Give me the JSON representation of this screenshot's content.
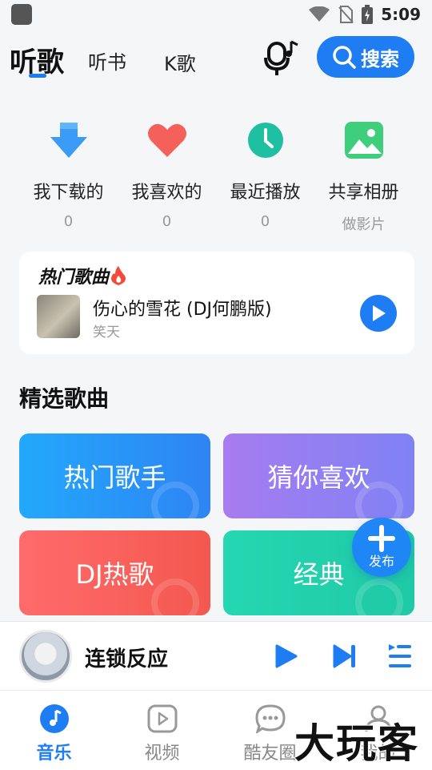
{
  "status_bar": {
    "time": "5:09"
  },
  "top_nav": {
    "tabs": [
      {
        "label": "听歌",
        "active": true
      },
      {
        "label": "听书"
      },
      {
        "label": "K歌"
      }
    ],
    "search_label": "搜索",
    "accent_color": "#1f7df3"
  },
  "quick_actions": [
    {
      "label": "我下载的",
      "sub": "0",
      "icon": "download-arrow-icon"
    },
    {
      "label": "我喜欢的",
      "sub": "0",
      "icon": "heart-icon"
    },
    {
      "label": "最近播放",
      "sub": "0",
      "icon": "clock-icon"
    },
    {
      "label": "共享相册",
      "sub": "做影片",
      "icon": "photo-album-icon"
    }
  ],
  "hot_songs": {
    "title": "热门歌曲",
    "song": "伤心的雪花 (DJ何鹏版)",
    "artist": "笑天"
  },
  "featured": {
    "title": "精选歌曲",
    "tiles": [
      {
        "label": "热门歌手"
      },
      {
        "label": "猜你喜欢"
      },
      {
        "label": "DJ热歌"
      },
      {
        "label": "经典"
      }
    ]
  },
  "fab": {
    "label": "发布"
  },
  "mini_player": {
    "title": "连锁反应"
  },
  "bottom_nav": [
    {
      "label": "音乐",
      "active": true,
      "icon": "music-note-icon"
    },
    {
      "label": "视频",
      "icon": "video-play-icon"
    },
    {
      "label": "酷友圈",
      "icon": "chat-bubble-icon"
    },
    {
      "label": "我的",
      "icon": "person-icon"
    }
  ],
  "watermark": "大玩客"
}
